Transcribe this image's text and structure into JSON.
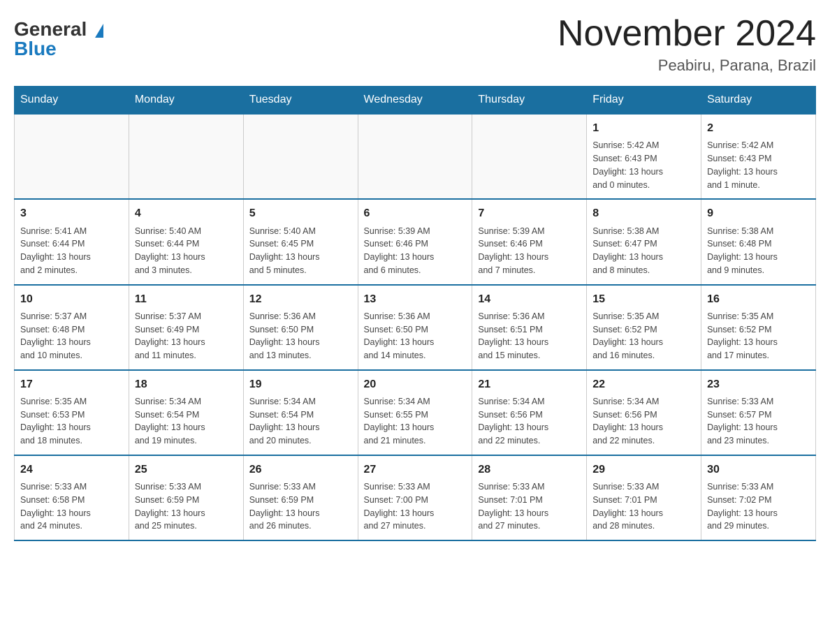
{
  "header": {
    "logo_general": "General",
    "logo_blue": "Blue",
    "title": "November 2024",
    "subtitle": "Peabiru, Parana, Brazil"
  },
  "days_of_week": [
    "Sunday",
    "Monday",
    "Tuesday",
    "Wednesday",
    "Thursday",
    "Friday",
    "Saturday"
  ],
  "weeks": [
    [
      {
        "day": "",
        "info": ""
      },
      {
        "day": "",
        "info": ""
      },
      {
        "day": "",
        "info": ""
      },
      {
        "day": "",
        "info": ""
      },
      {
        "day": "",
        "info": ""
      },
      {
        "day": "1",
        "info": "Sunrise: 5:42 AM\nSunset: 6:43 PM\nDaylight: 13 hours\nand 0 minutes."
      },
      {
        "day": "2",
        "info": "Sunrise: 5:42 AM\nSunset: 6:43 PM\nDaylight: 13 hours\nand 1 minute."
      }
    ],
    [
      {
        "day": "3",
        "info": "Sunrise: 5:41 AM\nSunset: 6:44 PM\nDaylight: 13 hours\nand 2 minutes."
      },
      {
        "day": "4",
        "info": "Sunrise: 5:40 AM\nSunset: 6:44 PM\nDaylight: 13 hours\nand 3 minutes."
      },
      {
        "day": "5",
        "info": "Sunrise: 5:40 AM\nSunset: 6:45 PM\nDaylight: 13 hours\nand 5 minutes."
      },
      {
        "day": "6",
        "info": "Sunrise: 5:39 AM\nSunset: 6:46 PM\nDaylight: 13 hours\nand 6 minutes."
      },
      {
        "day": "7",
        "info": "Sunrise: 5:39 AM\nSunset: 6:46 PM\nDaylight: 13 hours\nand 7 minutes."
      },
      {
        "day": "8",
        "info": "Sunrise: 5:38 AM\nSunset: 6:47 PM\nDaylight: 13 hours\nand 8 minutes."
      },
      {
        "day": "9",
        "info": "Sunrise: 5:38 AM\nSunset: 6:48 PM\nDaylight: 13 hours\nand 9 minutes."
      }
    ],
    [
      {
        "day": "10",
        "info": "Sunrise: 5:37 AM\nSunset: 6:48 PM\nDaylight: 13 hours\nand 10 minutes."
      },
      {
        "day": "11",
        "info": "Sunrise: 5:37 AM\nSunset: 6:49 PM\nDaylight: 13 hours\nand 11 minutes."
      },
      {
        "day": "12",
        "info": "Sunrise: 5:36 AM\nSunset: 6:50 PM\nDaylight: 13 hours\nand 13 minutes."
      },
      {
        "day": "13",
        "info": "Sunrise: 5:36 AM\nSunset: 6:50 PM\nDaylight: 13 hours\nand 14 minutes."
      },
      {
        "day": "14",
        "info": "Sunrise: 5:36 AM\nSunset: 6:51 PM\nDaylight: 13 hours\nand 15 minutes."
      },
      {
        "day": "15",
        "info": "Sunrise: 5:35 AM\nSunset: 6:52 PM\nDaylight: 13 hours\nand 16 minutes."
      },
      {
        "day": "16",
        "info": "Sunrise: 5:35 AM\nSunset: 6:52 PM\nDaylight: 13 hours\nand 17 minutes."
      }
    ],
    [
      {
        "day": "17",
        "info": "Sunrise: 5:35 AM\nSunset: 6:53 PM\nDaylight: 13 hours\nand 18 minutes."
      },
      {
        "day": "18",
        "info": "Sunrise: 5:34 AM\nSunset: 6:54 PM\nDaylight: 13 hours\nand 19 minutes."
      },
      {
        "day": "19",
        "info": "Sunrise: 5:34 AM\nSunset: 6:54 PM\nDaylight: 13 hours\nand 20 minutes."
      },
      {
        "day": "20",
        "info": "Sunrise: 5:34 AM\nSunset: 6:55 PM\nDaylight: 13 hours\nand 21 minutes."
      },
      {
        "day": "21",
        "info": "Sunrise: 5:34 AM\nSunset: 6:56 PM\nDaylight: 13 hours\nand 22 minutes."
      },
      {
        "day": "22",
        "info": "Sunrise: 5:34 AM\nSunset: 6:56 PM\nDaylight: 13 hours\nand 22 minutes."
      },
      {
        "day": "23",
        "info": "Sunrise: 5:33 AM\nSunset: 6:57 PM\nDaylight: 13 hours\nand 23 minutes."
      }
    ],
    [
      {
        "day": "24",
        "info": "Sunrise: 5:33 AM\nSunset: 6:58 PM\nDaylight: 13 hours\nand 24 minutes."
      },
      {
        "day": "25",
        "info": "Sunrise: 5:33 AM\nSunset: 6:59 PM\nDaylight: 13 hours\nand 25 minutes."
      },
      {
        "day": "26",
        "info": "Sunrise: 5:33 AM\nSunset: 6:59 PM\nDaylight: 13 hours\nand 26 minutes."
      },
      {
        "day": "27",
        "info": "Sunrise: 5:33 AM\nSunset: 7:00 PM\nDaylight: 13 hours\nand 27 minutes."
      },
      {
        "day": "28",
        "info": "Sunrise: 5:33 AM\nSunset: 7:01 PM\nDaylight: 13 hours\nand 27 minutes."
      },
      {
        "day": "29",
        "info": "Sunrise: 5:33 AM\nSunset: 7:01 PM\nDaylight: 13 hours\nand 28 minutes."
      },
      {
        "day": "30",
        "info": "Sunrise: 5:33 AM\nSunset: 7:02 PM\nDaylight: 13 hours\nand 29 minutes."
      }
    ]
  ]
}
